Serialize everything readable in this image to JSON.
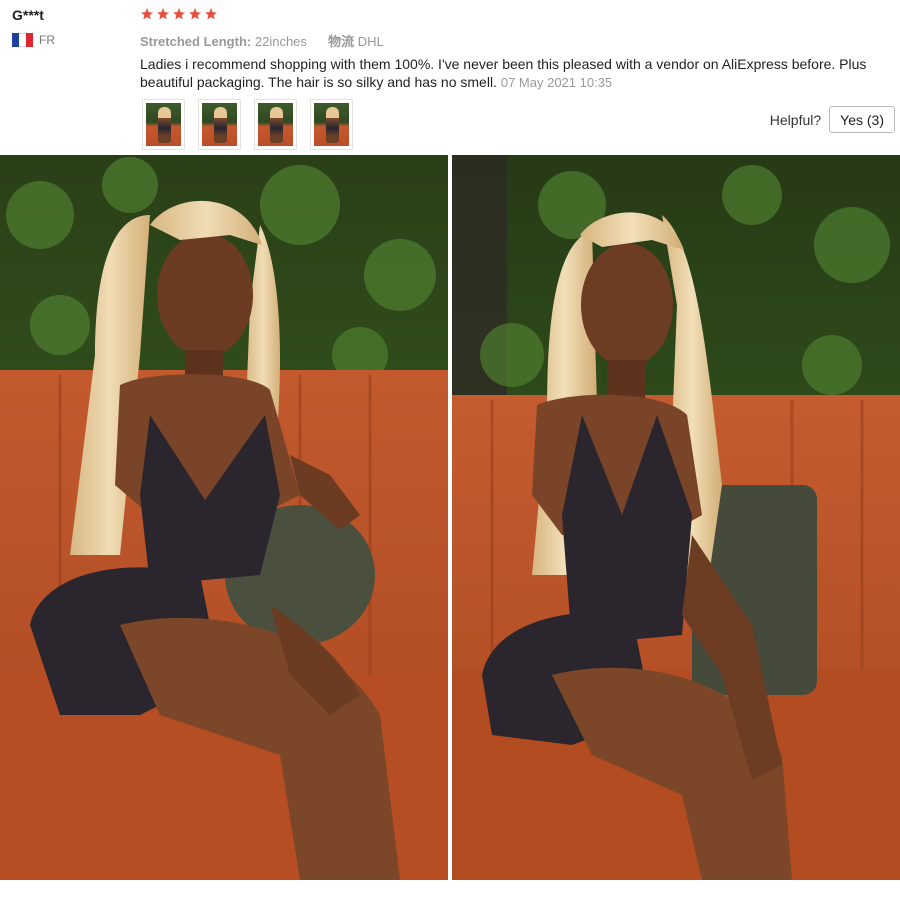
{
  "review": {
    "reviewer_name": "G***t",
    "country_code": "FR",
    "flag_icon": "france-flag-icon",
    "rating_stars": 5,
    "star_color": "#e74c3c",
    "attributes": [
      {
        "key": "Stretched Length:",
        "value": "22inches"
      },
      {
        "key": "物流",
        "value": "DHL"
      }
    ],
    "text": "Ladies i recommend shopping with them 100%. I've never been this pleased with a vendor on AliExpress before. Plus beautiful packaging. The hair is so silky and has no smell.",
    "date": "07 May 2021 10:35",
    "thumbnail_count": 4,
    "helpful_label": "Helpful?",
    "yes_label": "Yes (3)"
  }
}
